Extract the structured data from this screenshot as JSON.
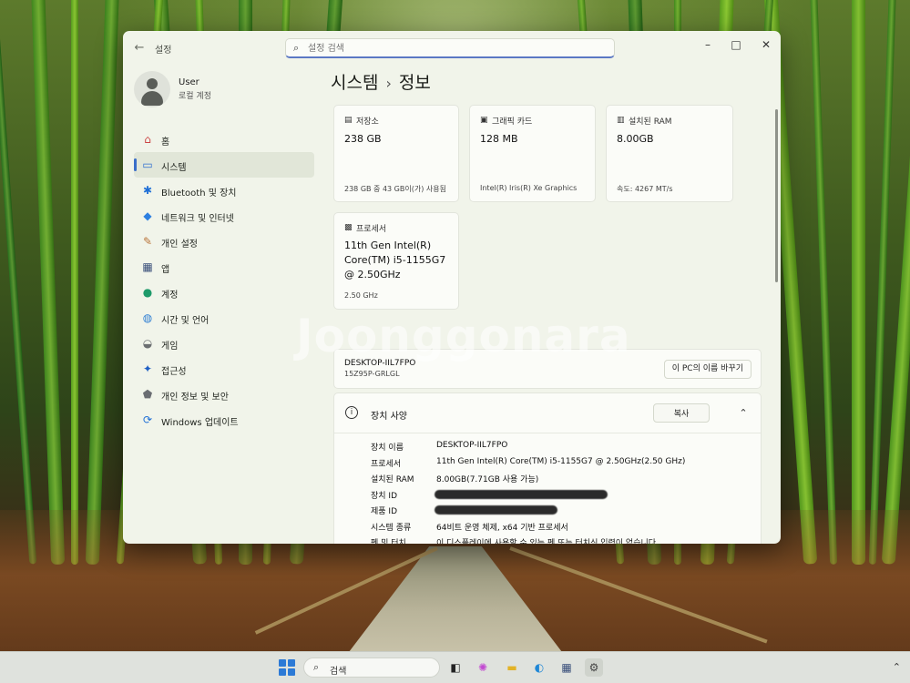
{
  "window": {
    "app_title": "설정",
    "search_placeholder": "설정 검색"
  },
  "user": {
    "name": "User",
    "account_type": "로컬 계정"
  },
  "sidebar": {
    "items": [
      {
        "label": "홈",
        "icon": "home-icon"
      },
      {
        "label": "시스템",
        "icon": "system-icon",
        "active": true
      },
      {
        "label": "Bluetooth 및 장치",
        "icon": "bluetooth-icon"
      },
      {
        "label": "네트워크 및 인터넷",
        "icon": "network-icon"
      },
      {
        "label": "개인 설정",
        "icon": "brush-icon"
      },
      {
        "label": "앱",
        "icon": "apps-icon"
      },
      {
        "label": "계정",
        "icon": "account-icon"
      },
      {
        "label": "시간 및 언어",
        "icon": "globe-icon"
      },
      {
        "label": "게임",
        "icon": "gamepad-icon"
      },
      {
        "label": "접근성",
        "icon": "accessibility-icon"
      },
      {
        "label": "개인 정보 및 보안",
        "icon": "shield-icon"
      },
      {
        "label": "Windows 업데이트",
        "icon": "update-icon"
      }
    ]
  },
  "breadcrumb": {
    "parent": "시스템",
    "separator": "›",
    "current": "정보"
  },
  "cards": {
    "storage": {
      "label": "저장소",
      "value": "238 GB",
      "sub": "238 GB 중 43 GB이(가) 사용됨"
    },
    "graphics": {
      "label": "그래픽 카드",
      "value": "128 MB",
      "sub": "Intel(R) Iris(R) Xe Graphics"
    },
    "ram": {
      "label": "설치된 RAM",
      "value": "8.00GB",
      "sub": "속도: 4267 MT/s"
    },
    "processor": {
      "label": "프로세서",
      "value": "11th Gen Intel(R) Core(TM) i5-1155G7 @ 2.50GHz",
      "sub": "2.50 GHz"
    }
  },
  "pc": {
    "name": "DESKTOP-IIL7FPO",
    "model": "15Z95P-GRLGL",
    "rename_label": "이 PC의 이름 바꾸기"
  },
  "specs": {
    "title": "장치 사양",
    "copy_label": "복사",
    "rows": [
      {
        "key": "장치 이름",
        "value": "DESKTOP-IIL7FPO"
      },
      {
        "key": "프로세서",
        "value": "11th Gen Intel(R) Core(TM) i5-1155G7 @ 2.50GHz(2.50 GHz)"
      },
      {
        "key": "설치된 RAM",
        "value": "8.00GB(7.71GB 사용 가능)"
      },
      {
        "key": "장치 ID",
        "value": ""
      },
      {
        "key": "제품 ID",
        "value": ""
      },
      {
        "key": "시스템 종류",
        "value": "64비트 운영 체제, x64 기반 프로세서"
      },
      {
        "key": "펜 및 터치",
        "value": "이 디스플레이에 사용할 수 있는 펜 또는 터치식 입력이 없습니다"
      }
    ]
  },
  "watermark": "Joonggonara",
  "taskbar": {
    "search_label": "검색"
  }
}
